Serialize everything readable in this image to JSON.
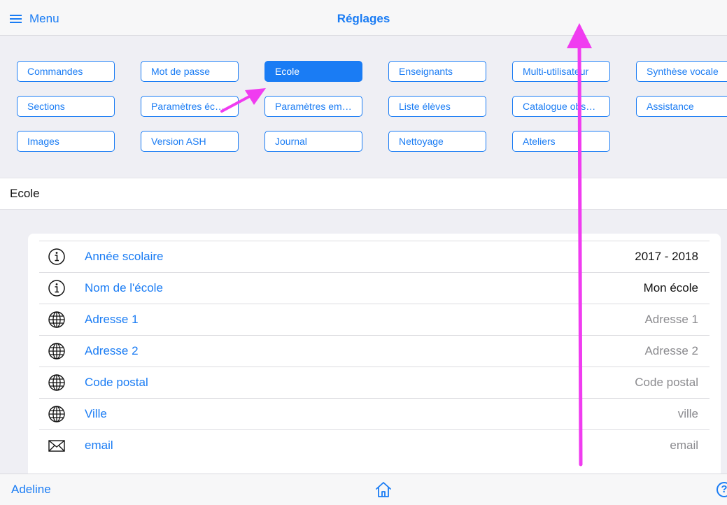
{
  "header": {
    "menu_label": "Menu",
    "title": "Réglages"
  },
  "settings_buttons": [
    {
      "label": "Commandes",
      "active": false
    },
    {
      "label": "Mot de passe",
      "active": false
    },
    {
      "label": "Ecole",
      "active": true
    },
    {
      "label": "Enseignants",
      "active": false
    },
    {
      "label": "Multi-utilisateur",
      "active": false
    },
    {
      "label": "Synthèse vocale",
      "active": false
    },
    {
      "label": "Sections",
      "active": false
    },
    {
      "label": "Paramètres écarts",
      "active": false
    },
    {
      "label": "Paramètres em…",
      "active": false
    },
    {
      "label": "Liste élèves",
      "active": false
    },
    {
      "label": "Catalogue observ…",
      "active": false
    },
    {
      "label": "Assistance",
      "active": false
    },
    {
      "label": "Images",
      "active": false
    },
    {
      "label": "Version ASH",
      "active": false
    },
    {
      "label": "Journal",
      "active": false
    },
    {
      "label": "Nettoyage",
      "active": false
    },
    {
      "label": "Ateliers",
      "active": false
    }
  ],
  "section": {
    "title": "Ecole"
  },
  "fields": [
    {
      "icon": "info-icon",
      "label": "Année scolaire",
      "value": "2017 - 2018",
      "value_is_placeholder": false
    },
    {
      "icon": "info-icon",
      "label": "Nom de l'école",
      "value": "Mon école",
      "value_is_placeholder": false
    },
    {
      "icon": "globe-icon",
      "label": "Adresse 1",
      "value": "Adresse 1",
      "value_is_placeholder": true
    },
    {
      "icon": "globe-icon",
      "label": "Adresse 2",
      "value": "Adresse 2",
      "value_is_placeholder": true
    },
    {
      "icon": "globe-icon",
      "label": "Code postal",
      "value": "Code postal",
      "value_is_placeholder": true
    },
    {
      "icon": "globe-icon",
      "label": "Ville",
      "value": "ville",
      "value_is_placeholder": true
    },
    {
      "icon": "envelope-icon",
      "label": "email",
      "value": "email",
      "value_is_placeholder": true
    }
  ],
  "footer": {
    "user_name": "Adeline",
    "help_label": "?"
  },
  "colors": {
    "accent": "#1a7cf4",
    "annotation_arrow": "#f03cf0"
  }
}
